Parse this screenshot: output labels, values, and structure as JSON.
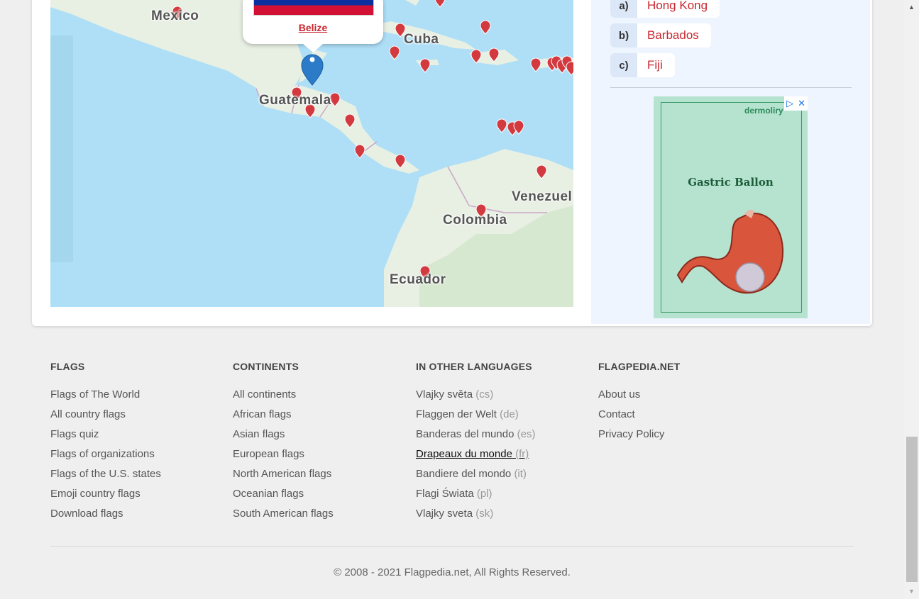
{
  "map": {
    "labels": {
      "mexico": "Mexico",
      "cuba": "Cuba",
      "guatemala": "Guatemala",
      "venezuela": "Venezuel",
      "colombia": "Colombia",
      "ecuador": "Ecuador"
    },
    "popup": {
      "link": "Belize"
    }
  },
  "quiz": {
    "answers": [
      {
        "letter": "a)",
        "name": "Hong Kong"
      },
      {
        "letter": "b)",
        "name": "Barbados"
      },
      {
        "letter": "c)",
        "name": "Fiji"
      }
    ]
  },
  "ad": {
    "brand": "dermoliry",
    "title": "Gastric Ballon",
    "adchoices_icon": "play-triangle-icon",
    "close_icon": "close-icon"
  },
  "footer": {
    "flags": {
      "heading": "FLAGS",
      "links": [
        "Flags of The World",
        "All country flags",
        "Flags quiz",
        "Flags of organizations",
        "Flags of the U.S. states",
        "Emoji country flags",
        "Download flags"
      ]
    },
    "continents": {
      "heading": "CONTINENTS",
      "links": [
        "All continents",
        "African flags",
        "Asian flags",
        "European flags",
        "North American flags",
        "Oceanian flags",
        "South American flags"
      ]
    },
    "languages": {
      "heading": "IN OTHER LANGUAGES",
      "links": [
        {
          "label": "Vlajky světa",
          "code": "(cs)"
        },
        {
          "label": "Flaggen der Welt",
          "code": "(de)"
        },
        {
          "label": "Banderas del mundo",
          "code": "(es)"
        },
        {
          "label": "Drapeaux du monde",
          "code": "(fr)"
        },
        {
          "label": "Bandiere del mondo",
          "code": "(it)"
        },
        {
          "label": "Flagi Świata",
          "code": "(pl)"
        },
        {
          "label": "Vlajky sveta",
          "code": "(sk)"
        }
      ]
    },
    "flagpedia": {
      "heading": "FLAGPEDIA.NET",
      "links": [
        "About us",
        "Contact",
        "Privacy Policy"
      ]
    },
    "copyright": "© 2008 - 2021 Flagpedia.net, All Rights Reserved."
  }
}
